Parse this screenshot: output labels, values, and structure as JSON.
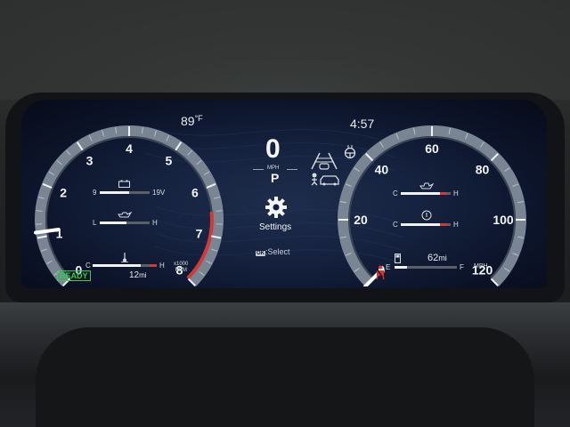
{
  "temperature": {
    "value": "89",
    "unit": "°F"
  },
  "clock": "4:57",
  "tachometer": {
    "labels": [
      "0",
      "1",
      "2",
      "3",
      "4",
      "5",
      "6",
      "7",
      "8"
    ],
    "unit_line1": "x1000",
    "unit_line2": "RPM",
    "redline_from": 6.5,
    "needle_value": 1.1
  },
  "left_minis": {
    "battery": {
      "min": "9",
      "max": "19V",
      "fill_fraction": 0.6
    },
    "oil": {
      "low": "L",
      "high": "H",
      "fill_fraction": 0.55
    },
    "coolant": {
      "cold": "C",
      "hot": "H",
      "fill_fraction": 0.75
    }
  },
  "ready_badge": "READY",
  "range_left": {
    "value": "12",
    "unit": "mi"
  },
  "center": {
    "speed": "0",
    "speed_unit": "MPH",
    "gear": "P",
    "settings_label": "Settings",
    "select_hint": ":Select",
    "ok_badge": "OK"
  },
  "speedometer": {
    "labels": [
      "0",
      "20",
      "40",
      "60",
      "80",
      "100",
      "120"
    ],
    "unit": "MPH",
    "needle_value": 0
  },
  "right_minis": {
    "trans_temp": {
      "cold": "C",
      "hot": "H",
      "fill_fraction": 0.9
    },
    "diff_temp": {
      "cold": "C",
      "hot": "H",
      "fill_fraction": 0.9
    },
    "fuel": {
      "empty": "E",
      "full": "F",
      "fill_fraction": 0.15
    }
  },
  "range_right": {
    "value": "62",
    "unit": "mi"
  },
  "colors": {
    "accent_red": "#d23a3a",
    "ready_green": "#2fd14a",
    "gauge_ring": "#7a8594",
    "screen_bg": "#0c142a"
  },
  "icons": [
    "lane-assist-icon",
    "pre-collision-icon",
    "steering-wheel-icon",
    "settings-gear-icon",
    "seatbelt-warning-icon",
    "battery-icon",
    "oil-can-icon",
    "coolant-thermometer-icon",
    "fuel-pump-icon"
  ]
}
